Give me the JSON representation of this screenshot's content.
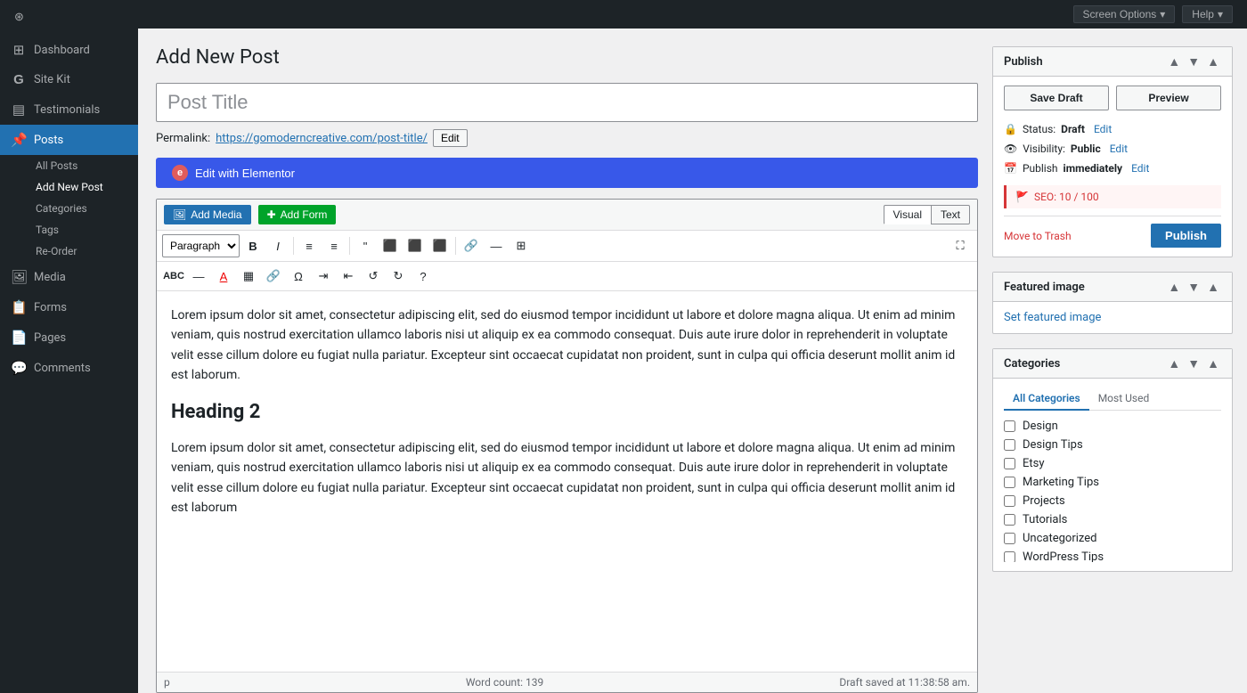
{
  "sidebar": {
    "items": [
      {
        "id": "dashboard",
        "label": "Dashboard",
        "icon": "⊞"
      },
      {
        "id": "site-kit",
        "label": "Site Kit",
        "icon": "G"
      },
      {
        "id": "testimonials",
        "label": "Testimonials",
        "icon": "▤"
      },
      {
        "id": "posts",
        "label": "Posts",
        "icon": "📌",
        "active": true
      },
      {
        "id": "media",
        "label": "Media",
        "icon": "🖼"
      },
      {
        "id": "forms",
        "label": "Forms",
        "icon": "📋"
      },
      {
        "id": "pages",
        "label": "Pages",
        "icon": "📄"
      },
      {
        "id": "comments",
        "label": "Comments",
        "icon": "💬"
      }
    ],
    "posts_subitems": [
      {
        "id": "all-posts",
        "label": "All Posts"
      },
      {
        "id": "add-new-post",
        "label": "Add New Post",
        "active": true
      },
      {
        "id": "categories",
        "label": "Categories"
      },
      {
        "id": "tags",
        "label": "Tags"
      },
      {
        "id": "re-order",
        "label": "Re-Order"
      }
    ]
  },
  "topbar": {
    "screen_options_label": "Screen Options",
    "help_label": "Help"
  },
  "page_title": "Add New Post",
  "post_title_placeholder": "Post Title",
  "permalink": {
    "label": "Permalink:",
    "url": "https://gomoderncreative.com/post-title/",
    "edit_label": "Edit"
  },
  "elementor_btn": "Edit with Elementor",
  "editor": {
    "add_media_label": "Add Media",
    "add_form_label": "Add Form",
    "visual_tab": "Visual",
    "text_tab": "Text",
    "paragraph_select": "Paragraph",
    "toolbar_buttons": [
      "B",
      "I",
      "≡",
      "≡",
      "\"",
      "≡",
      "≡",
      "≡",
      "🔗",
      "—",
      "⊞"
    ],
    "toolbar2_buttons": [
      "ABC",
      "—",
      "A",
      "⊞",
      "🔗",
      "Ω",
      "≡",
      "≡",
      "↺",
      "↻",
      "?"
    ],
    "body_paragraph1": "Lorem ipsum dolor sit amet, consectetur adipiscing elit, sed do eiusmod tempor incididunt ut labore et dolore magna aliqua. Ut enim ad minim veniam, quis nostrud exercitation ullamco laboris nisi ut aliquip ex ea commodo consequat. Duis aute irure dolor in reprehenderit in voluptate velit esse cillum dolore eu fugiat nulla pariatur. Excepteur sint occaecat cupidatat non proident, sunt in culpa qui officia deserunt mollit anim id est laborum.",
    "heading2": "Heading 2",
    "body_paragraph2": "Lorem ipsum dolor sit amet, consectetur adipiscing elit, sed do eiusmod tempor incididunt ut labore et dolore magna aliqua. Ut enim ad minim veniam, quis nostrud exercitation ullamco laboris nisi ut aliquip ex ea commodo consequat. Duis aute irure dolor in reprehenderit in voluptate velit esse cillum dolore eu fugiat nulla pariatur. Excepteur sint occaecat cupidatat non proident, sunt in culpa qui officia deserunt mollit anim id est laborum",
    "footer_p": "p",
    "word_count_label": "Word count:",
    "word_count": "139",
    "draft_saved": "Draft saved at 11:38:58 am."
  },
  "publish_box": {
    "title": "Publish",
    "save_draft_label": "Save Draft",
    "preview_label": "Preview",
    "status_label": "Status:",
    "status_value": "Draft",
    "status_edit": "Edit",
    "visibility_label": "Visibility:",
    "visibility_value": "Public",
    "visibility_edit": "Edit",
    "publish_label": "Publish",
    "publish_value": "immediately",
    "publish_edit": "Edit",
    "seo_label": "SEO: 10 / 100",
    "move_trash": "Move to Trash",
    "publish_btn": "Publish"
  },
  "featured_image_box": {
    "title": "Featured image",
    "set_link": "Set featured image"
  },
  "categories_box": {
    "title": "Categories",
    "tab_all": "All Categories",
    "tab_most_used": "Most Used",
    "items": [
      {
        "label": "Design",
        "checked": false
      },
      {
        "label": "Design Tips",
        "checked": false
      },
      {
        "label": "Etsy",
        "checked": false
      },
      {
        "label": "Marketing Tips",
        "checked": false
      },
      {
        "label": "Projects",
        "checked": false
      },
      {
        "label": "Tutorials",
        "checked": false
      },
      {
        "label": "Uncategorized",
        "checked": false
      },
      {
        "label": "WordPress Tips",
        "checked": false
      }
    ]
  }
}
